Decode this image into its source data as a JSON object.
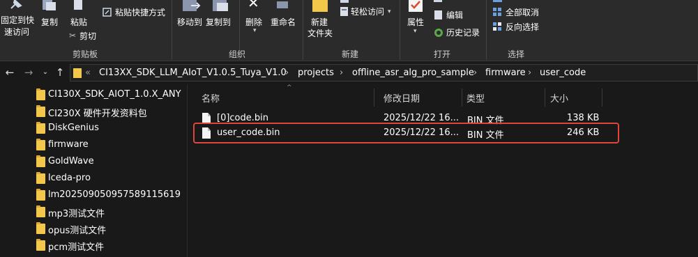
{
  "ribbon": {
    "clipboard": {
      "pin_label_line1": "固定到快",
      "pin_label_line2": "速访问",
      "copy": "复制",
      "paste": "粘贴",
      "cut": "剪切",
      "paste_shortcut": "粘贴快捷方式",
      "group_label": "剪贴板"
    },
    "organize": {
      "move_to": "移动到",
      "copy_to": "复制到",
      "delete": "删除",
      "rename": "重命名",
      "group_label": "组织"
    },
    "new": {
      "new_folder_line1": "新建",
      "new_folder_line2": "文件夹",
      "easy_access": "轻松访问",
      "group_label": "新建"
    },
    "open": {
      "properties": "属性",
      "edit": "编辑",
      "history": "历史记录",
      "group_label": "打开"
    },
    "select": {
      "select_none": "全部取消",
      "invert_selection": "反向选择",
      "group_label": "选择"
    }
  },
  "address": {
    "overflow": "«",
    "crumbs": [
      "CI13XX_SDK_LLM_AIoT_V1.0.5_Tuya_V1.0",
      "projects",
      "offline_asr_alg_pro_sample",
      "firmware",
      "user_code"
    ],
    "separator": "›"
  },
  "nav_pane": {
    "items": [
      {
        "label": "CI130X_SDK_AIOT_1.0.X_ANY"
      },
      {
        "label": "CI230X 硬件开发资料包"
      },
      {
        "label": "DiskGenius"
      },
      {
        "label": "firmware"
      },
      {
        "label": "GoldWave"
      },
      {
        "label": "lceda-pro"
      },
      {
        "label": "lm20250905095758911561​9"
      },
      {
        "label": "mp3测试文件"
      },
      {
        "label": "opus测试文件"
      },
      {
        "label": "pcm测试文件"
      }
    ]
  },
  "file_list": {
    "columns": {
      "name": "名称",
      "modified": "修改日期",
      "type": "类型",
      "size": "大小"
    },
    "rows": [
      {
        "name": "[0]code.bin",
        "modified": "2025/12/22 16...",
        "type": "BIN 文件",
        "size": "138 KB"
      },
      {
        "name": "user_code.bin",
        "modified": "2025/12/22 16...",
        "type": "BIN 文件",
        "size": "246 KB"
      }
    ]
  },
  "colors": {
    "highlight_box": "#e0463a",
    "folder": "#f3c74a"
  }
}
